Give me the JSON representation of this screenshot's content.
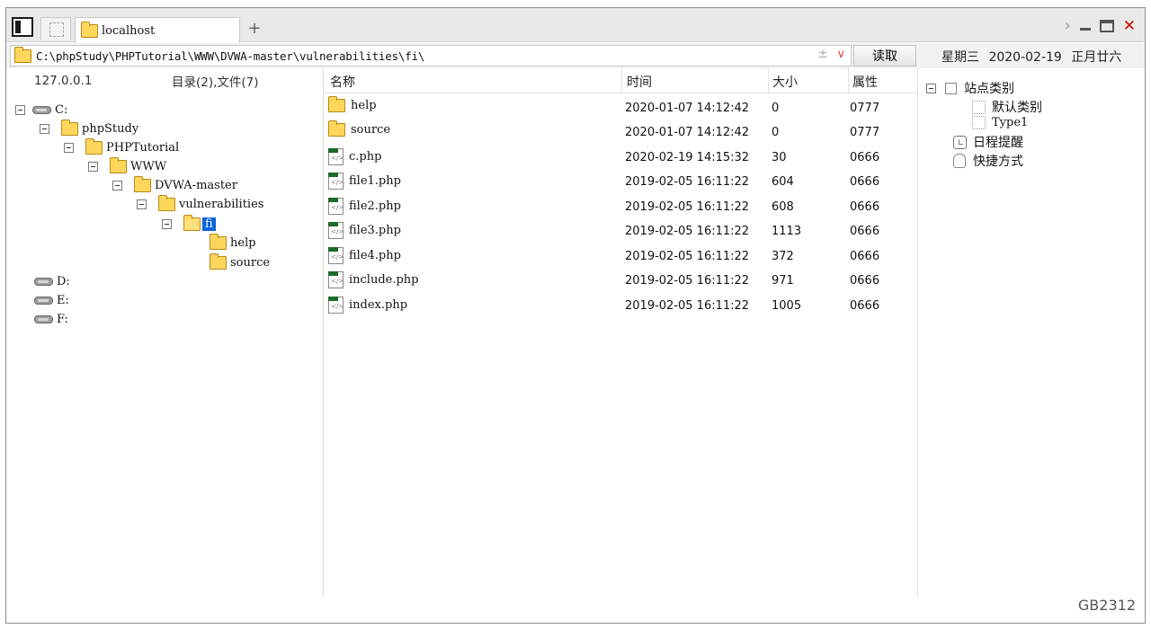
{
  "tabs": {
    "active_title": "localhost",
    "new_tab_label": "+"
  },
  "address": {
    "path": "C:\\phpStudy\\PHPTutorial\\WWW\\DVWA-master\\vulnerabilities\\fi\\",
    "plusminus": "±",
    "dropdown": "∨",
    "read_button": "读取"
  },
  "datebar": {
    "weekday": "星期三",
    "date": "2020-02-19",
    "lunar": "正月廿六"
  },
  "tree": {
    "host": "127.0.0.1",
    "summary": "目录(2),文件(7)",
    "nodes": [
      {
        "label": "C:"
      },
      {
        "label": "phpStudy"
      },
      {
        "label": "PHPTutorial"
      },
      {
        "label": "WWW"
      },
      {
        "label": "DVWA-master"
      },
      {
        "label": "vulnerabilities"
      },
      {
        "label": "fi"
      },
      {
        "label": "help"
      },
      {
        "label": "source"
      },
      {
        "label": "D:"
      },
      {
        "label": "E:"
      },
      {
        "label": "F:"
      }
    ]
  },
  "list": {
    "headers": {
      "name": "名称",
      "time": "时间",
      "size": "大小",
      "attr": "属性"
    },
    "rows": [
      {
        "name": "help",
        "time": "2020-01-07 14:12:42",
        "size": "0",
        "attr": "0777"
      },
      {
        "name": "source",
        "time": "2020-01-07 14:12:42",
        "size": "0",
        "attr": "0777"
      },
      {
        "name": "c.php",
        "time": "2020-02-19 14:15:32",
        "size": "30",
        "attr": "0666"
      },
      {
        "name": "file1.php",
        "time": "2019-02-05 16:11:22",
        "size": "604",
        "attr": "0666"
      },
      {
        "name": "file2.php",
        "time": "2019-02-05 16:11:22",
        "size": "608",
        "attr": "0666"
      },
      {
        "name": "file3.php",
        "time": "2019-02-05 16:11:22",
        "size": "1113",
        "attr": "0666"
      },
      {
        "name": "file4.php",
        "time": "2019-02-05 16:11:22",
        "size": "372",
        "attr": "0666"
      },
      {
        "name": "include.php",
        "time": "2019-02-05 16:11:22",
        "size": "971",
        "attr": "0666"
      },
      {
        "name": "index.php",
        "time": "2019-02-05 16:11:22",
        "size": "1005",
        "attr": "0666"
      }
    ]
  },
  "sidebar": {
    "site_category": "站点类别",
    "default_category": "默认类别",
    "type1": "Type1",
    "schedule": "日程提醒",
    "shortcuts": "快捷方式"
  },
  "status": {
    "encoding": "GB2312"
  }
}
